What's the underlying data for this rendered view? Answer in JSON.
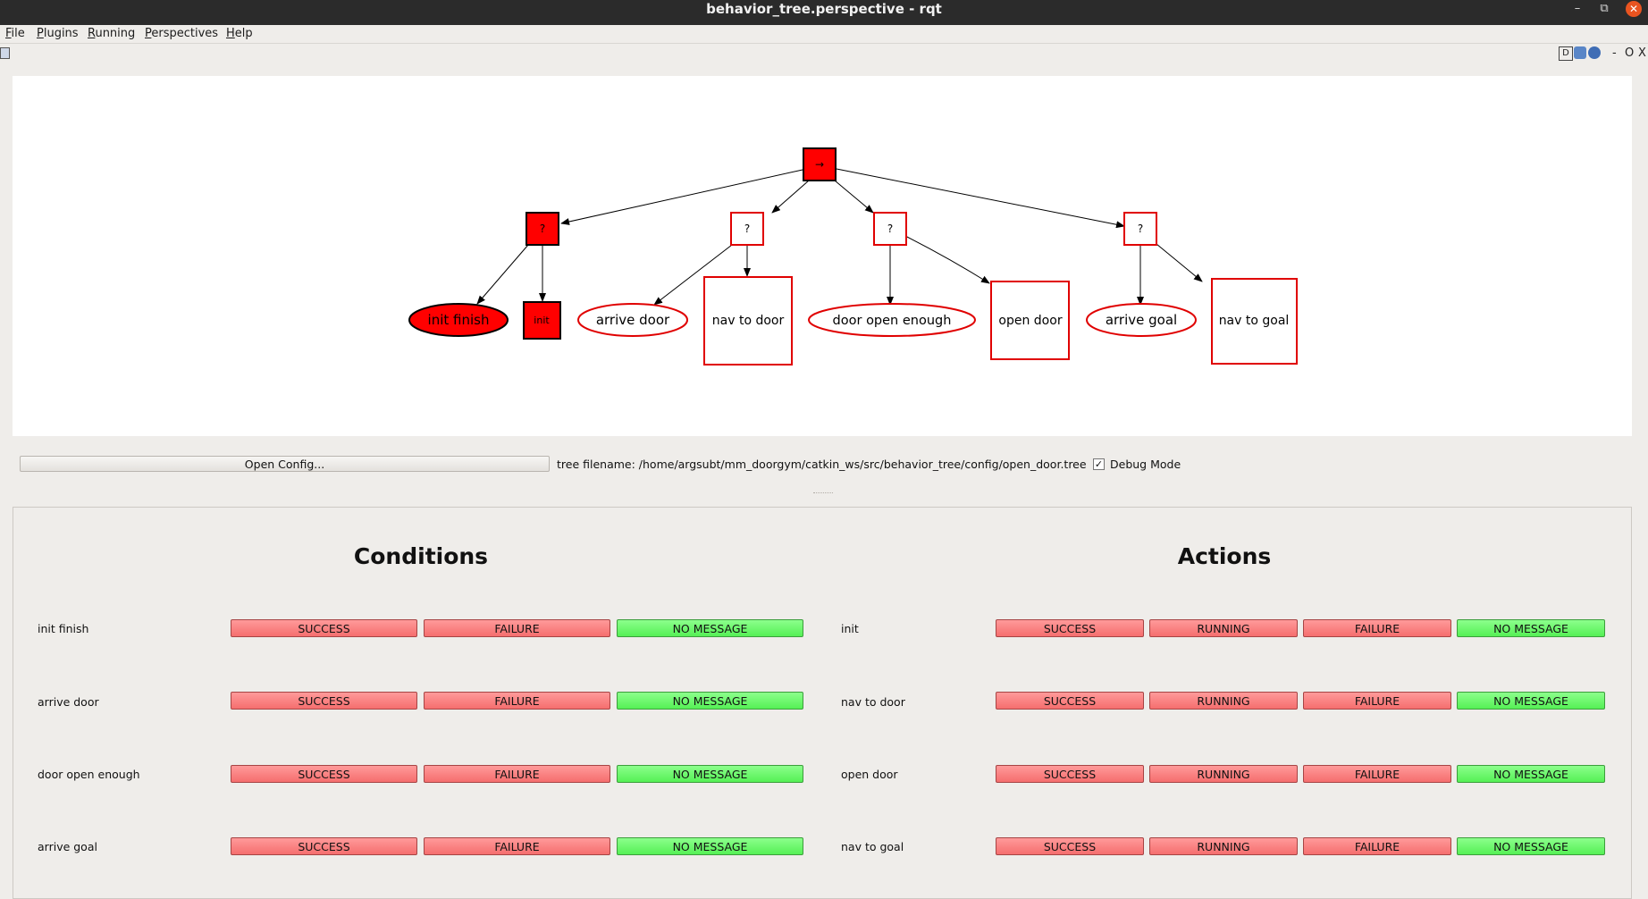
{
  "window": {
    "title": "behavior_tree.perspective - rqt",
    "min_glyph": "–",
    "restore_glyph": "⧉",
    "close_glyph": "✕"
  },
  "menu": [
    "File",
    "Plugins",
    "Running",
    "Perspectives",
    "Help"
  ],
  "dock": {
    "d_label": "D",
    "minimize": "-",
    "float": "O",
    "close": "X"
  },
  "tree": {
    "root_label": "→",
    "selectors": [
      "?",
      "?",
      "?",
      "?"
    ],
    "leaves": [
      "init finish",
      "init",
      "arrive door",
      "nav to door",
      "door open enough",
      "open door",
      "arrive goal",
      "nav to goal"
    ]
  },
  "controls": {
    "open_config_label": "Open Config...",
    "tree_filename": "tree filename: /home/argsubt/mm_doorgym/catkin_ws/src/behavior_tree/config/open_door.tree",
    "debug_checked": "✓",
    "debug_label": "Debug Mode"
  },
  "conditions": {
    "title": "Conditions",
    "buttons": [
      "SUCCESS",
      "FAILURE",
      "NO MESSAGE"
    ],
    "rows": [
      "init finish",
      "arrive door",
      "door open enough",
      "arrive goal"
    ]
  },
  "actions": {
    "title": "Actions",
    "buttons": [
      "SUCCESS",
      "RUNNING",
      "FAILURE",
      "NO MESSAGE"
    ],
    "rows": [
      "init",
      "nav to door",
      "open door",
      "nav to goal"
    ]
  },
  "colors": {
    "active_red": "#ff0000",
    "inactive_outline": "#e00000",
    "button_red": "#f56e6e",
    "button_green": "#55f055"
  }
}
